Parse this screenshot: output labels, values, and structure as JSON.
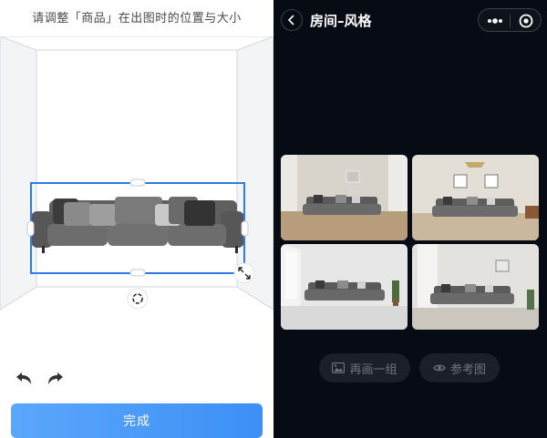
{
  "left": {
    "instruction": "请调整「商品」在出图时的位置与大小",
    "done_label": "完成",
    "icons": [
      "undo-icon",
      "redo-icon",
      "rotate-icon",
      "resize-icon"
    ]
  },
  "right": {
    "title": "房间–风格",
    "actions": {
      "regenerate_label": "再画一组",
      "reference_label": "参考图"
    },
    "thumbnails": [
      "style-thumbnail-1",
      "style-thumbnail-2",
      "style-thumbnail-3",
      "style-thumbnail-4"
    ],
    "icons": [
      "back-icon",
      "more-icon",
      "close-miniprogram-icon",
      "image-icon",
      "eye-icon"
    ]
  },
  "colors": {
    "accent_blue": "#3d8ff5",
    "dark_bg": "#060b14",
    "sofa": "#6a6a6a",
    "selection": "#2f7be6"
  }
}
